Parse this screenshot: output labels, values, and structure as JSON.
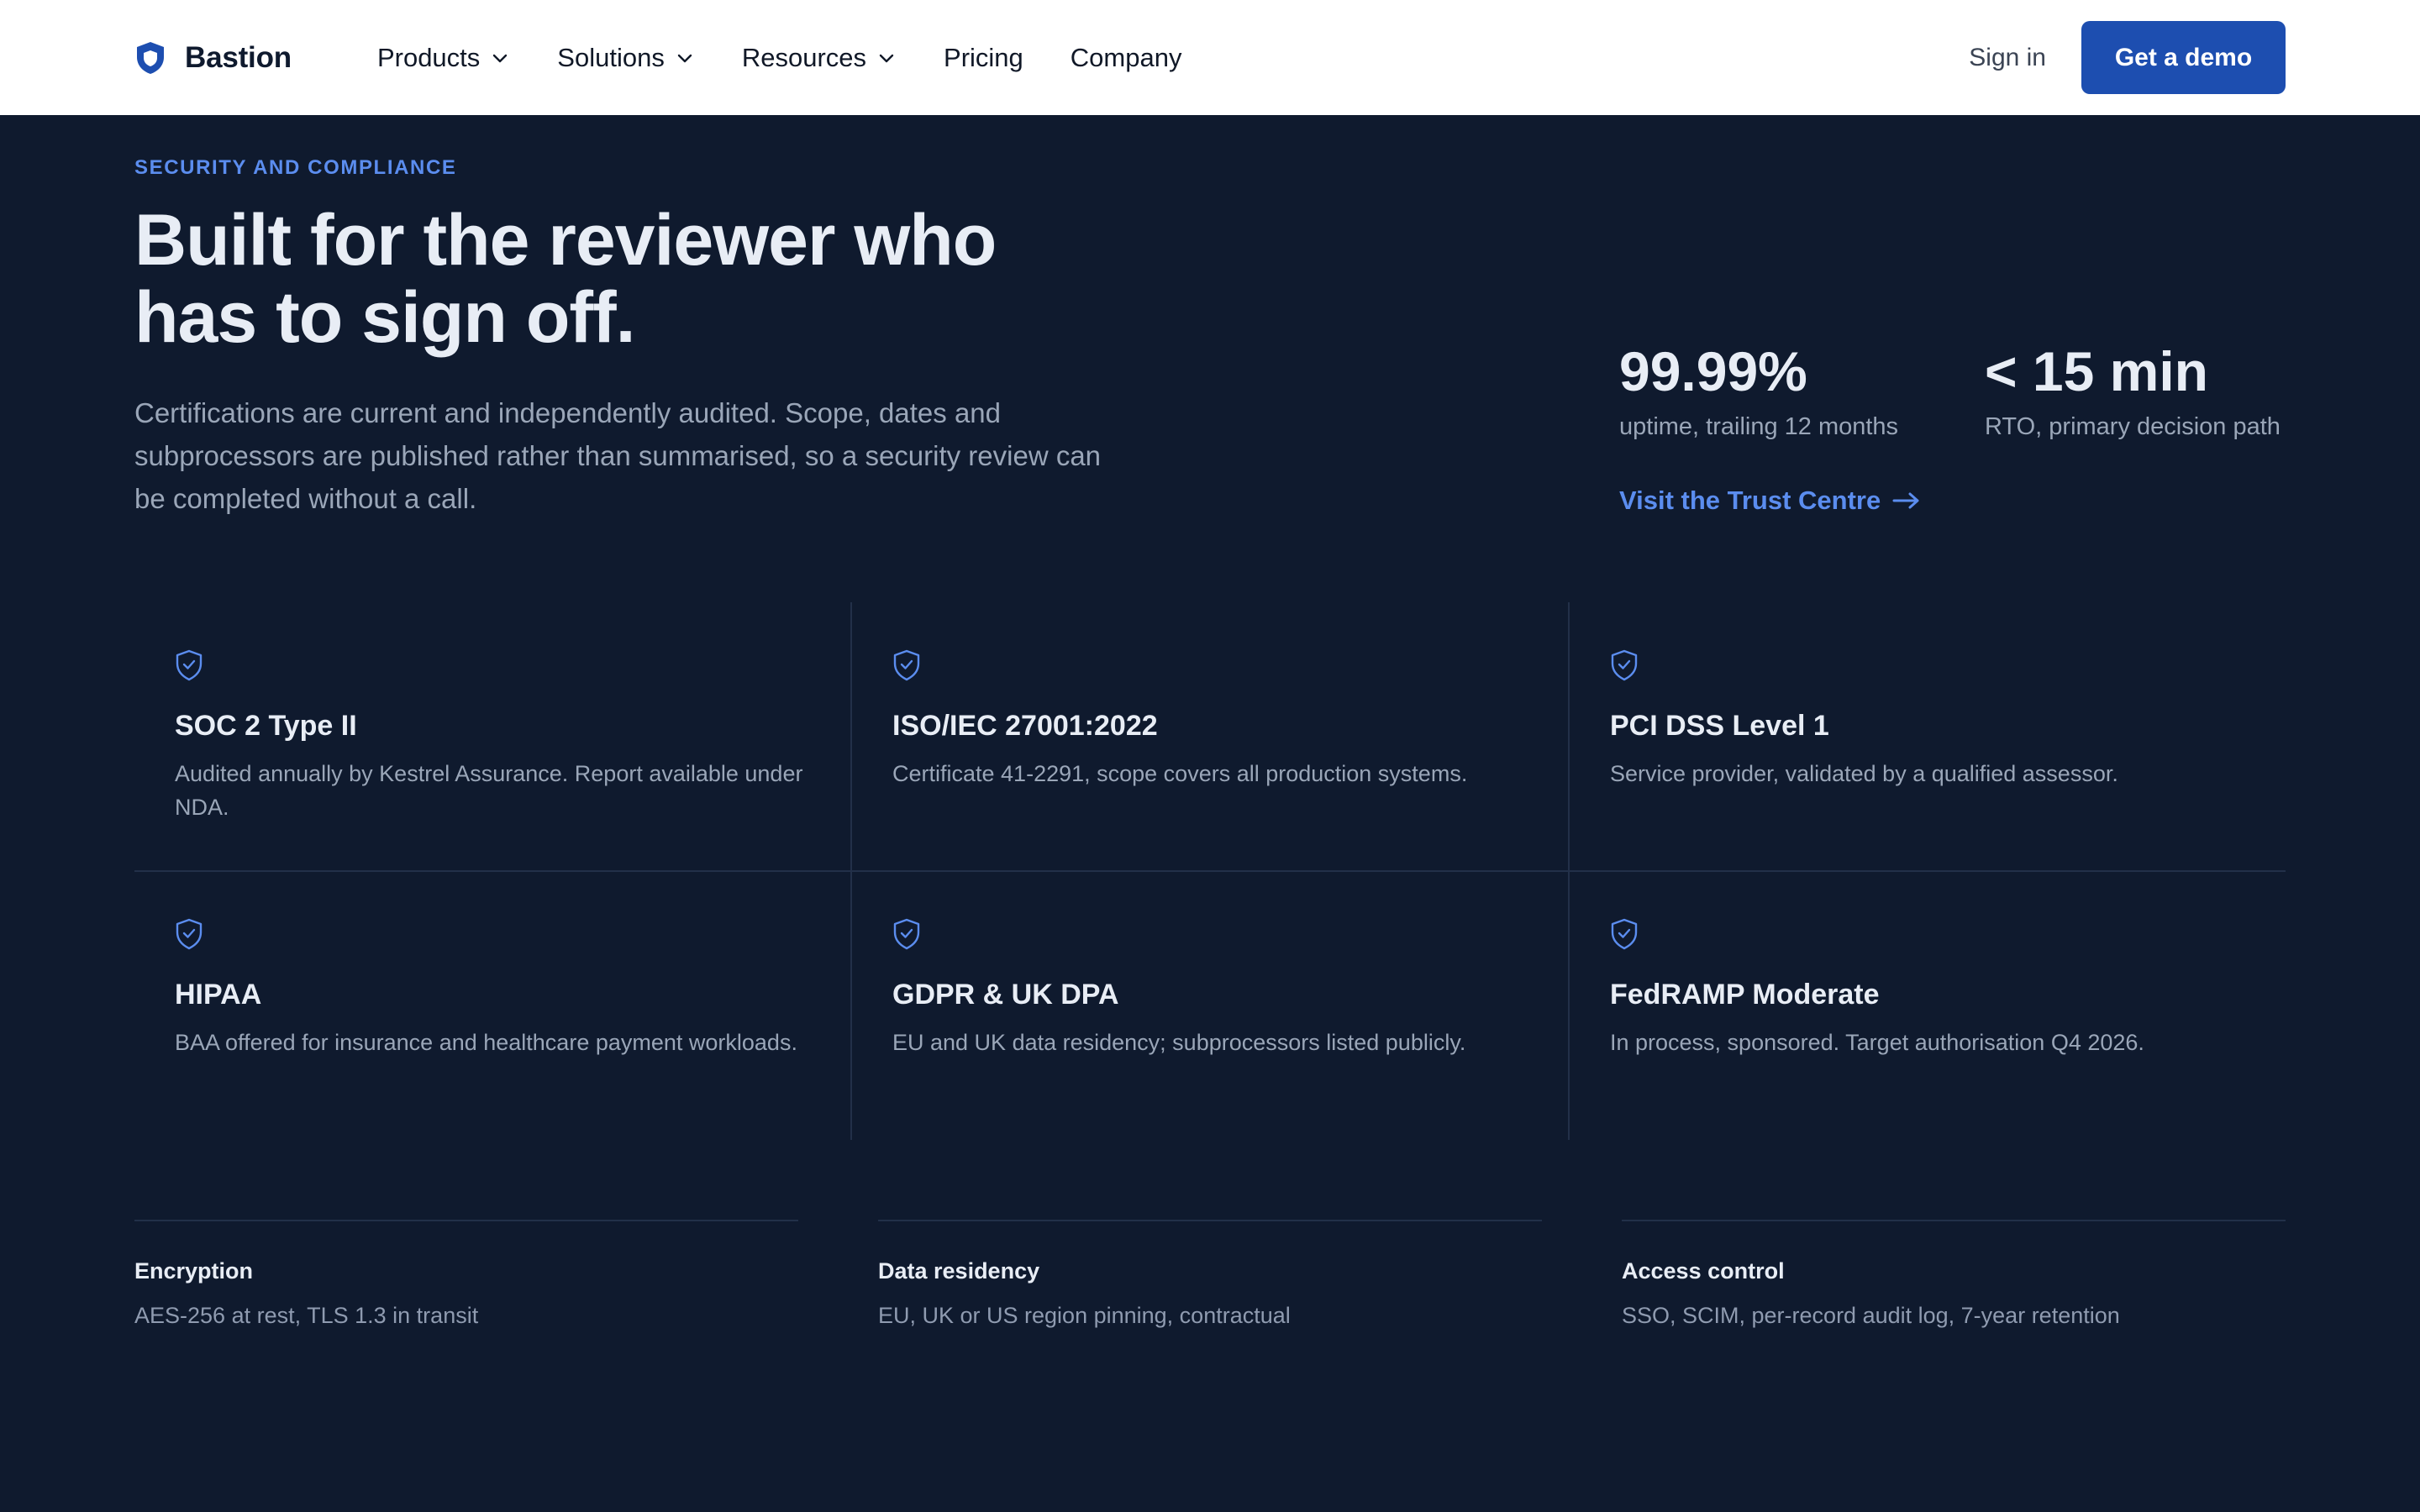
{
  "nav": {
    "brand": "Bastion",
    "links": [
      {
        "label": "Products",
        "dropdown": true
      },
      {
        "label": "Solutions",
        "dropdown": true
      },
      {
        "label": "Resources",
        "dropdown": true
      },
      {
        "label": "Pricing",
        "dropdown": false
      },
      {
        "label": "Company",
        "dropdown": false
      }
    ],
    "sign_in": "Sign in",
    "cta": "Get a demo"
  },
  "hero": {
    "eyebrow": "SECURITY AND COMPLIANCE",
    "headline_line1": "Built for the reviewer who",
    "headline_line2": "has to sign off.",
    "lede": "Certifications are current and independently audited. Scope, dates and subprocessors are published rather than summarised, so a security review can be completed without a call."
  },
  "stats": [
    {
      "value": "99.99%",
      "label": "uptime, trailing 12 months"
    },
    {
      "value": "< 15 min",
      "label": "RTO, primary decision path"
    }
  ],
  "trust_link": "Visit the Trust Centre",
  "certifications": [
    {
      "title": "SOC 2 Type II",
      "desc": "Audited annually by Kestrel Assurance. Report available under NDA."
    },
    {
      "title": "ISO/IEC 27001:2022",
      "desc": "Certificate 41-2291, scope covers all production systems."
    },
    {
      "title": "PCI DSS Level 1",
      "desc": "Service provider, validated by a qualified assessor."
    },
    {
      "title": "HIPAA",
      "desc": "BAA offered for insurance and healthcare payment workloads."
    },
    {
      "title": "GDPR & UK DPA",
      "desc": "EU and UK data residency; subprocessors listed publicly."
    },
    {
      "title": "FedRAMP Moderate",
      "desc": "In process, sponsored. Target authorisation Q4 2026."
    }
  ],
  "features": [
    {
      "title": "Encryption",
      "desc": "AES-256 at rest, TLS 1.3 in transit"
    },
    {
      "title": "Data residency",
      "desc": "EU, UK or US region pinning, contractual"
    },
    {
      "title": "Access control",
      "desc": "SSO, SCIM, per-record audit log, 7-year retention"
    }
  ],
  "colors": {
    "background": "#0f1a2e",
    "accent": "#5b8def",
    "cta": "#1d4eb0",
    "brand_icon": "#1d4eb0"
  },
  "icons": {
    "brand": "shield-icon",
    "dropdown": "chevron-down-icon",
    "certification": "shield-check-icon",
    "link": "arrow-right-icon"
  }
}
